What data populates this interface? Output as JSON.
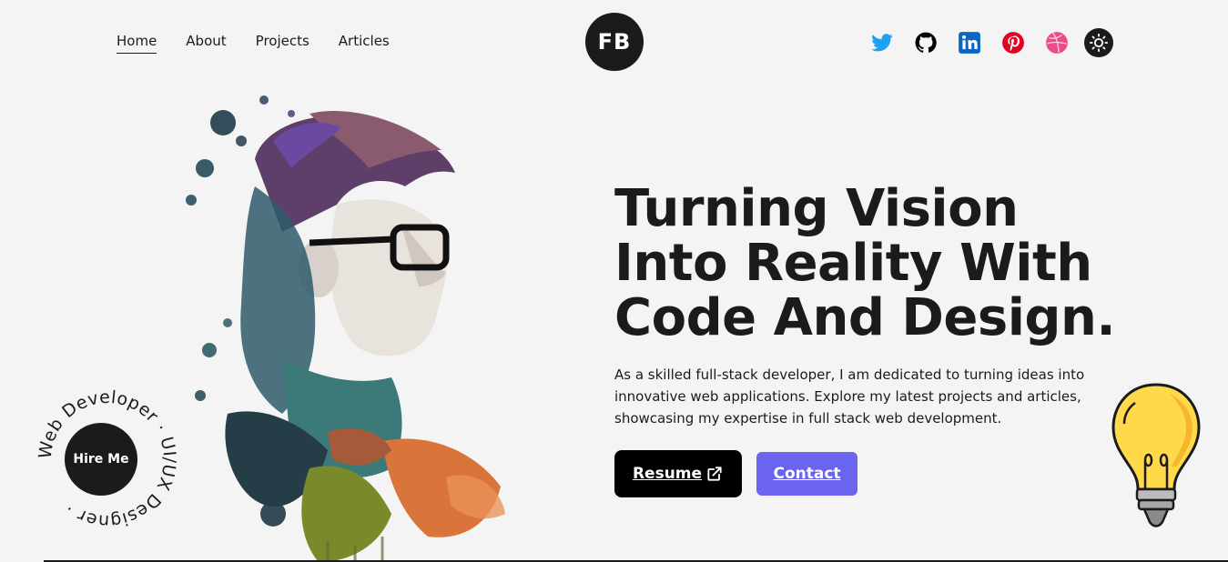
{
  "nav": {
    "items": [
      {
        "label": "Home",
        "active": true
      },
      {
        "label": "About"
      },
      {
        "label": "Projects"
      },
      {
        "label": "Articles"
      }
    ]
  },
  "logo": {
    "text": "FB"
  },
  "socials": [
    {
      "icon": "twitter-icon",
      "color": "#1da1f2"
    },
    {
      "icon": "github-icon",
      "color": "#000000"
    },
    {
      "icon": "linkedin-icon",
      "color": "#0a66c2"
    },
    {
      "icon": "pinterest-icon",
      "color": "#e60023"
    },
    {
      "icon": "dribbble-icon",
      "color": "#ea4c89"
    },
    {
      "icon": "sun-icon",
      "color": "#1b1b1b"
    }
  ],
  "badge": {
    "ring_text": "Web Developer · UI/UX Designer ·",
    "button_label": "Hire Me"
  },
  "hero": {
    "headline": "Turning Vision Into Reality With Code And Design.",
    "intro": "As a skilled full-stack developer, I am dedicated to turning ideas into innovative web applications. Explore my latest projects and articles, showcasing my expertise in full stack web development.",
    "resume_label": "Resume",
    "contact_label": "Contact"
  },
  "colors": {
    "accent": "#6a64ee",
    "dark": "#1b1b1b",
    "background": "#f4f4f4"
  }
}
